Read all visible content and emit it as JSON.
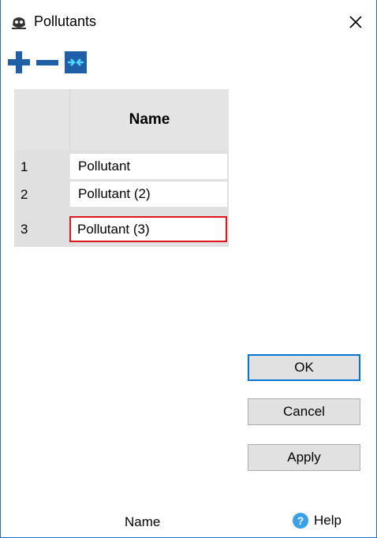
{
  "window": {
    "title": "Pollutants"
  },
  "toolbar": {
    "add_label": "",
    "remove_label": "",
    "sort_label": ""
  },
  "grid": {
    "header": "Name",
    "rows": [
      {
        "num": "1",
        "name": "Pollutant"
      },
      {
        "num": "2",
        "name": "Pollutant (2)"
      },
      {
        "num": "3",
        "name": "Pollutant (3)"
      }
    ]
  },
  "buttons": {
    "ok": "OK",
    "cancel": "Cancel",
    "apply": "Apply"
  },
  "status": {
    "field": "Name",
    "help": "Help"
  },
  "colors": {
    "accent": "#1c6fc9",
    "selection": "#e0161b",
    "icon_blue": "#1f5fa8"
  }
}
